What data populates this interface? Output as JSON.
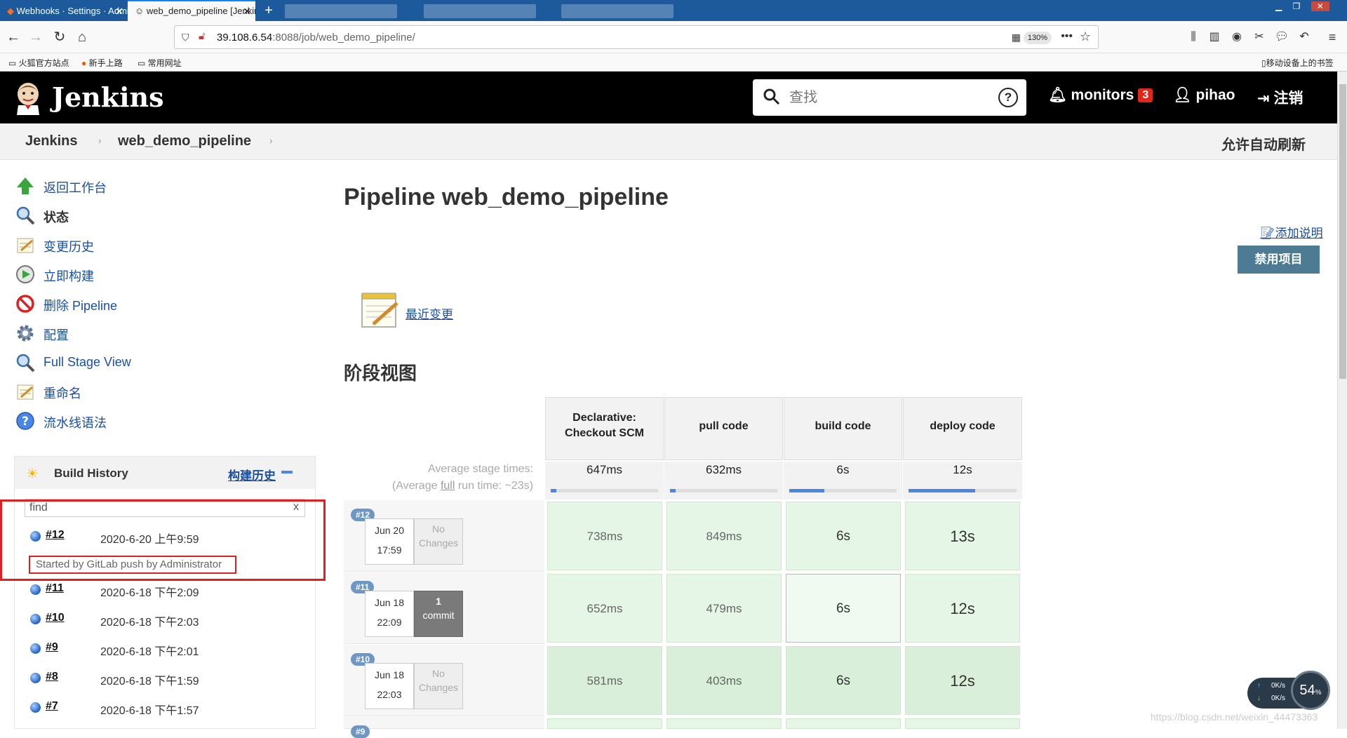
{
  "browser": {
    "tabs": [
      {
        "title": "Webhooks · Settings · Admin",
        "active": false
      },
      {
        "title": "web_demo_pipeline [Jenkins]",
        "active": true
      }
    ],
    "url_host": "39.108.6.54",
    "url_rest": ":8088/job/web_demo_pipeline/",
    "zoom": "130%",
    "bookmarks": [
      "火狐官方站点",
      "新手上路",
      "常用网址"
    ],
    "mobile_bookmarks": "移动设备上的书签"
  },
  "header": {
    "logo": "Jenkins",
    "search_placeholder": "查找",
    "monitors_label": "monitors",
    "monitors_count": "3",
    "user": "pihao",
    "logout": "注销"
  },
  "breadcrumb": {
    "root": "Jenkins",
    "job": "web_demo_pipeline",
    "auto_refresh": "允许自动刷新"
  },
  "sidebar": {
    "tasks": [
      {
        "label": "返回工作台",
        "icon": "up-arrow-icon"
      },
      {
        "label": "状态",
        "icon": "magnifier-icon"
      },
      {
        "label": "变更历史",
        "icon": "notepad-icon"
      },
      {
        "label": "立即构建",
        "icon": "clock-play-icon"
      },
      {
        "label": "删除 Pipeline",
        "icon": "no-entry-icon"
      },
      {
        "label": "配置",
        "icon": "gear-icon"
      },
      {
        "label": "Full Stage View",
        "icon": "magnifier-icon"
      },
      {
        "label": "重命名",
        "icon": "notepad-icon"
      },
      {
        "label": "流水线语法",
        "icon": "help-icon"
      }
    ],
    "build_history": {
      "title": "Build History",
      "link": "构建历史",
      "filter_value": "find",
      "filter_clear": "x",
      "builds": [
        {
          "num": "#12",
          "date": "2020-6-20 上午9:59",
          "cause": "Started by GitLab push by Administrator"
        },
        {
          "num": "#11",
          "date": "2020-6-18 下午2:09"
        },
        {
          "num": "#10",
          "date": "2020-6-18 下午2:03"
        },
        {
          "num": "#9",
          "date": "2020-6-18 下午2:01"
        },
        {
          "num": "#8",
          "date": "2020-6-18 下午1:59"
        },
        {
          "num": "#7",
          "date": "2020-6-18 下午1:57"
        }
      ]
    }
  },
  "main": {
    "title": "Pipeline web_demo_pipeline",
    "add_description": "添加说明",
    "disable_button": "禁用项目",
    "recent_changes": "最近变更",
    "stage_view_title": "阶段视图",
    "avg_label_1": "Average stage times:",
    "avg_label_2_pre": "(Average ",
    "avg_label_2_link": "full",
    "avg_label_2_post": " run time: ~23s)",
    "stages": [
      {
        "name_1": "Declarative:",
        "name_2": "Checkout SCM",
        "avg": "647ms",
        "progress": 0.05
      },
      {
        "name_1": "pull code",
        "name_2": "",
        "avg": "632ms",
        "progress": 0.05
      },
      {
        "name_1": "build code",
        "name_2": "",
        "avg": "6s",
        "progress": 0.33
      },
      {
        "name_1": "deploy code",
        "name_2": "",
        "avg": "12s",
        "progress": 0.62
      }
    ],
    "runs": [
      {
        "tag": "#12",
        "date": "Jun 20",
        "time": "17:59",
        "changes_1": "No",
        "changes_2": "Changes",
        "cells": [
          "738ms",
          "849ms",
          "6s",
          "13s"
        ]
      },
      {
        "tag": "#11",
        "date": "Jun 18",
        "time": "22:09",
        "changes_1": "1",
        "changes_2": "commit",
        "cells": [
          "652ms",
          "479ms",
          "6s",
          "12s"
        ]
      },
      {
        "tag": "#10",
        "date": "Jun 18",
        "time": "22:03",
        "changes_1": "No",
        "changes_2": "Changes",
        "cells": [
          "581ms",
          "403ms",
          "6s",
          "12s"
        ]
      },
      {
        "tag": "#9"
      }
    ]
  },
  "overlay": {
    "speed_up": "0K/s",
    "speed_down": "0K/s",
    "percent": "54",
    "watermark": "https://blog.csdn.net/weixin_44473363"
  },
  "colors": {
    "header_bg": "#000000",
    "stage_success": "#e6f6e6",
    "highlight_box": "#e02020",
    "link": "#1a4fa0"
  }
}
